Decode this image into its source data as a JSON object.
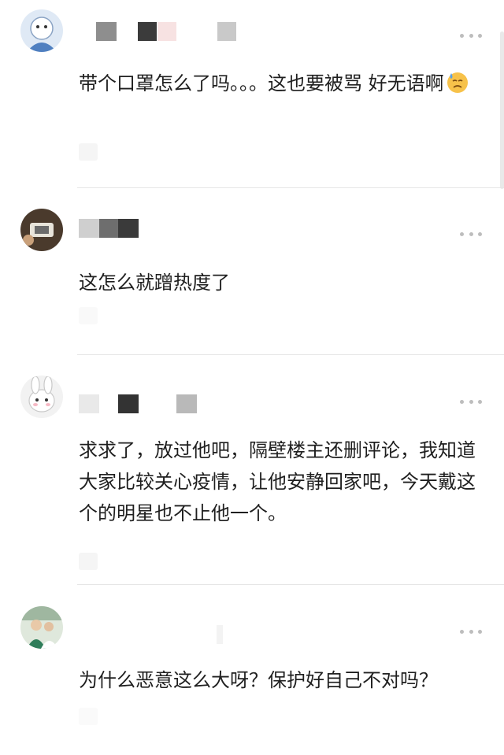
{
  "comments": [
    {
      "text": "带个口罩怎么了吗。。。这也要被骂 好无语啊",
      "avatar_icon": "cartoon-avatar-icon",
      "emoji_icon": "sweat-face-emoji-icon"
    },
    {
      "text": "这怎么就蹭热度了",
      "avatar_icon": "camera-avatar-icon"
    },
    {
      "text": "求求了，放过他吧，隔壁楼主还删评论，我知道大家比较关心疫情，让他安静回家吧，今天戴这个的明星也不止他一个。",
      "avatar_icon": "rabbit-avatar-icon"
    },
    {
      "text": "为什么恶意这么大呀？保护好自己不对吗？",
      "avatar_icon": "photo-avatar-icon"
    }
  ],
  "ui": {
    "more_icon": "more-dots-icon",
    "colors": {
      "text": "#1f1f1f",
      "divider": "#e6e6e6",
      "dots": "#bdbdbd"
    }
  }
}
